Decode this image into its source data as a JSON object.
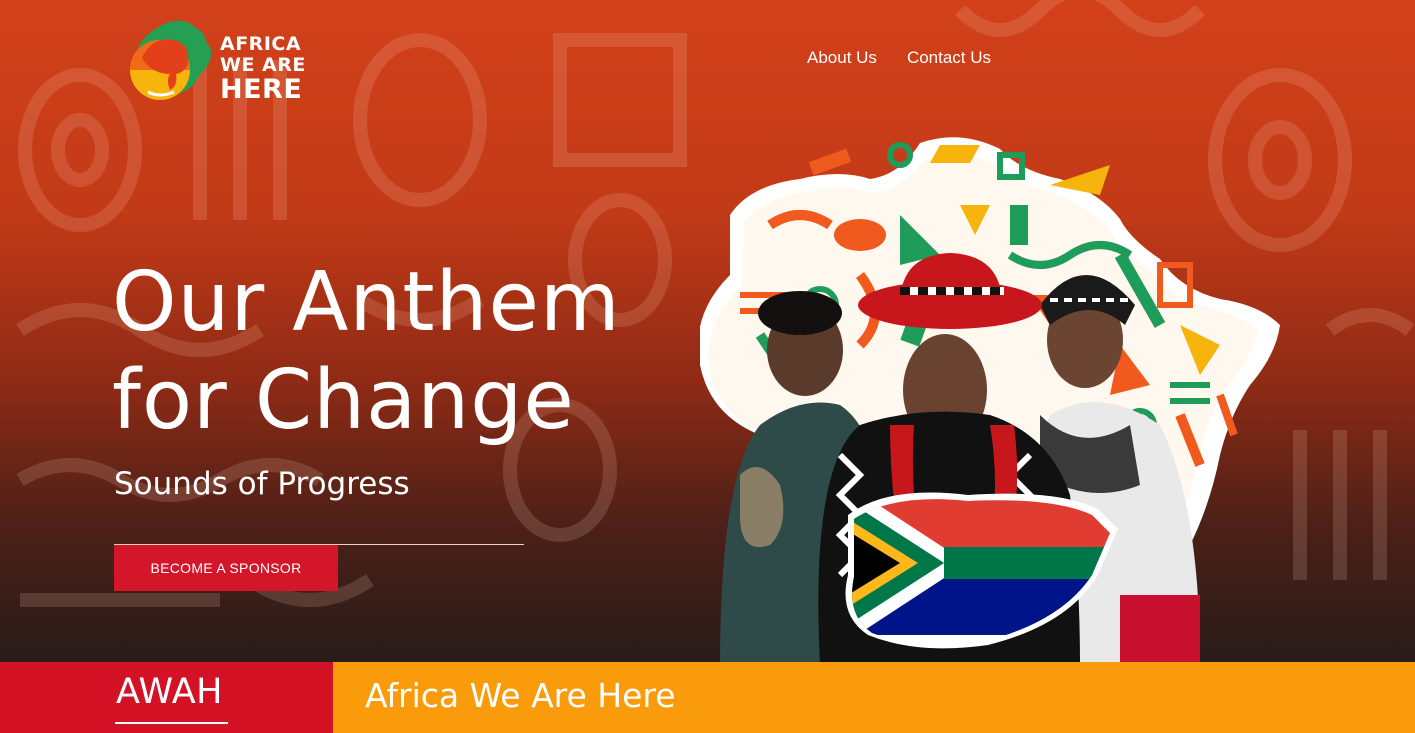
{
  "brand": {
    "logo_text_line1": "AFRICA",
    "logo_text_line2": "WE ARE",
    "logo_text_line3": "HERE"
  },
  "nav": {
    "items": [
      {
        "label": "About Us"
      },
      {
        "label": "Contact Us"
      }
    ]
  },
  "hero": {
    "headline_line1": "Our Anthem",
    "headline_line2": "for Change",
    "subheading": "Sounds of Progress",
    "cta_label": "BECOME A SPONSOR"
  },
  "footer_bar": {
    "short_name": "AWAH",
    "full_name": "Africa We Are Here"
  },
  "icons": [
    "elephant-africa-logo-icon",
    "africa-map-pattern-art",
    "south-africa-flag-map-art"
  ],
  "colors": {
    "hero_top": "#d2411a",
    "hero_bottom": "#2a1c19",
    "cta": "#d4162a",
    "bar_red": "#d31225",
    "bar_orange": "#f99b0b",
    "pattern_green": "#1f9b5a",
    "pattern_orange": "#f05a1e",
    "pattern_yellow": "#f7b40d"
  }
}
